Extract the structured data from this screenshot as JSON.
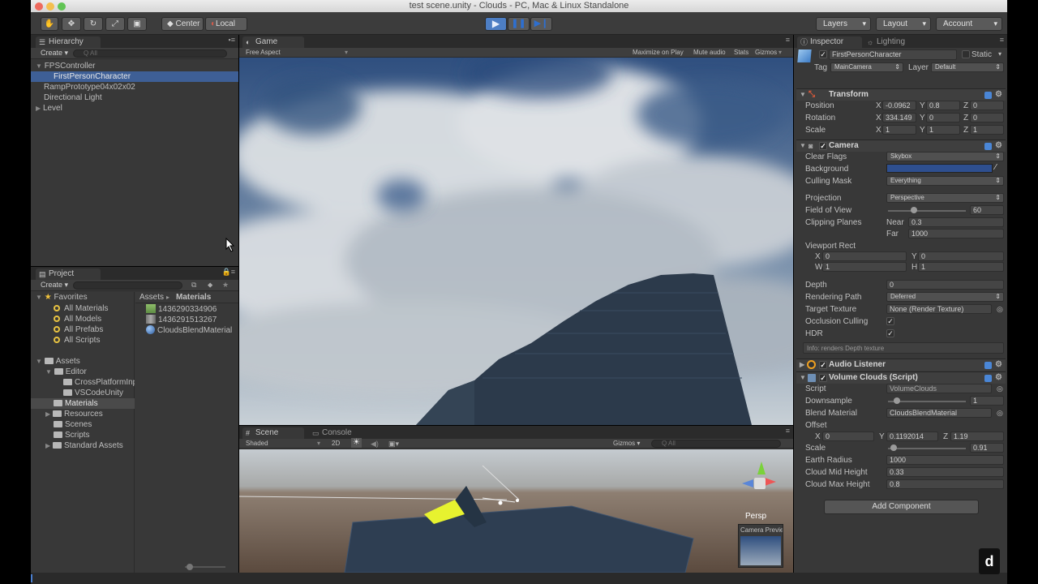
{
  "window": {
    "title": "test scene.unity - Clouds - PC, Mac & Linux Standalone"
  },
  "toolbar": {
    "pivot_label": "Center",
    "space_label": "Local",
    "layers_label": "Layers",
    "layout_label": "Layout",
    "account_label": "Account"
  },
  "hierarchy": {
    "tab": "Hierarchy",
    "create": "Create",
    "search_placeholder": "Q All",
    "items": [
      "FPSController",
      "FirstPersonCharacter",
      "RampPrototype04x02x02",
      "Directional Light",
      "Level"
    ]
  },
  "project": {
    "tab": "Project",
    "create": "Create",
    "favorites_label": "Favorites",
    "favorites": [
      "All Materials",
      "All Models",
      "All Prefabs",
      "All Scripts"
    ],
    "assets_label": "Assets",
    "tree": [
      "Editor",
      "CrossPlatformInput",
      "VSCodeUnity",
      "Materials",
      "Resources",
      "Scenes",
      "Scripts",
      "Standard Assets"
    ],
    "breadcrumb_root": "Assets",
    "breadcrumb_leaf": "Materials",
    "files": [
      "1436290334906",
      "1436291513267",
      "CloudsBlendMaterial"
    ]
  },
  "game": {
    "tab": "Game",
    "aspect": "Free Aspect",
    "options": [
      "Maximize on Play",
      "Mute audio",
      "Stats",
      "Gizmos"
    ]
  },
  "scene": {
    "tab": "Scene",
    "console_tab": "Console",
    "shading": "Shaded",
    "mode_2d": "2D",
    "gizmos": "Gizmos",
    "search_placeholder": "Q All",
    "persp_label": "Persp",
    "camera_preview": "Camera Preview"
  },
  "inspector": {
    "tab": "Inspector",
    "lighting_tab": "Lighting",
    "object_name": "FirstPersonCharacter",
    "static_label": "Static",
    "tag_label": "Tag",
    "tag_value": "MainCamera",
    "layer_label": "Layer",
    "layer_value": "Default",
    "transform": {
      "title": "Transform",
      "position_label": "Position",
      "position": [
        "-0.0962",
        "0.8",
        "0"
      ],
      "rotation_label": "Rotation",
      "rotation": [
        "334.149",
        "0",
        "0"
      ],
      "scale_label": "Scale",
      "scale": [
        "1",
        "1",
        "1"
      ]
    },
    "camera": {
      "title": "Camera",
      "clear_flags_label": "Clear Flags",
      "clear_flags": "Skybox",
      "background_label": "Background",
      "background_color": "#2e4f8f",
      "culling_mask_label": "Culling Mask",
      "culling_mask": "Everything",
      "projection_label": "Projection",
      "projection": "Perspective",
      "fov_label": "Field of View",
      "fov": "60",
      "clipping_label": "Clipping Planes",
      "near_label": "Near",
      "near": "0.3",
      "far_label": "Far",
      "far": "1000",
      "viewport_label": "Viewport Rect",
      "vp_x": "0",
      "vp_y": "0",
      "vp_w": "1",
      "vp_h": "1",
      "depth_label": "Depth",
      "depth": "0",
      "rendering_path_label": "Rendering Path",
      "rendering_path": "Deferred",
      "target_texture_label": "Target Texture",
      "target_texture": "None (Render Texture)",
      "occlusion_label": "Occlusion Culling",
      "hdr_label": "HDR",
      "info": "Info: renders Depth texture"
    },
    "audio_listener": {
      "title": "Audio Listener"
    },
    "volume_clouds": {
      "title": "Volume Clouds (Script)",
      "script_label": "Script",
      "script": "VolumeClouds",
      "downsample_label": "Downsample",
      "downsample": "1",
      "blend_label": "Blend Material",
      "blend": "CloudsBlendMaterial",
      "offset_label": "Offset",
      "offset": [
        "0",
        "0.1192014",
        "1.19"
      ],
      "scale_label": "Scale",
      "scale": "0.91",
      "earth_radius_label": "Earth Radius",
      "earth_radius": "1000",
      "mid_height_label": "Cloud Mid Height",
      "mid_height": "0.33",
      "max_height_label": "Cloud Max Height",
      "max_height": "0.8"
    },
    "add_component": "Add Component"
  },
  "watermark": "d"
}
